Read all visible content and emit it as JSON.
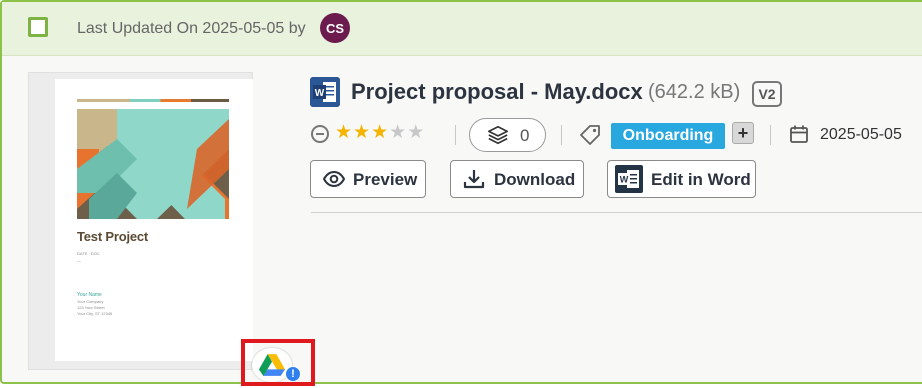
{
  "header": {
    "updated_text": "Last Updated On 2025-05-05 by",
    "avatar_initials": "CS"
  },
  "thumbnail": {
    "doc_title": "Test Project",
    "doc_date_line": "DATE · DOC",
    "doc_dash": "—",
    "doc_name": "Your Name",
    "doc_company": "Your Company",
    "doc_street": "123 Your Street",
    "doc_city": "Your City, ST 12345"
  },
  "file": {
    "title": "Project proposal - May.docx",
    "size": "(642.2 kB)",
    "version": "V2"
  },
  "meta": {
    "rating": 3,
    "rating_max": 5,
    "layers_count": "0",
    "tag": "Onboarding",
    "add_tag": "+",
    "date": "2025-05-05"
  },
  "actions": {
    "preview": "Preview",
    "download": "Download",
    "edit": "Edit in Word"
  },
  "drive_badge": {
    "info_symbol": "!"
  },
  "colors": {
    "header_bg": "#e9f2dd",
    "border_green": "#8cc14a",
    "tag_blue": "#29a8e0",
    "star_gold": "#f5b400",
    "word_blue": "#2b5797",
    "highlight_red": "#e0191f"
  }
}
